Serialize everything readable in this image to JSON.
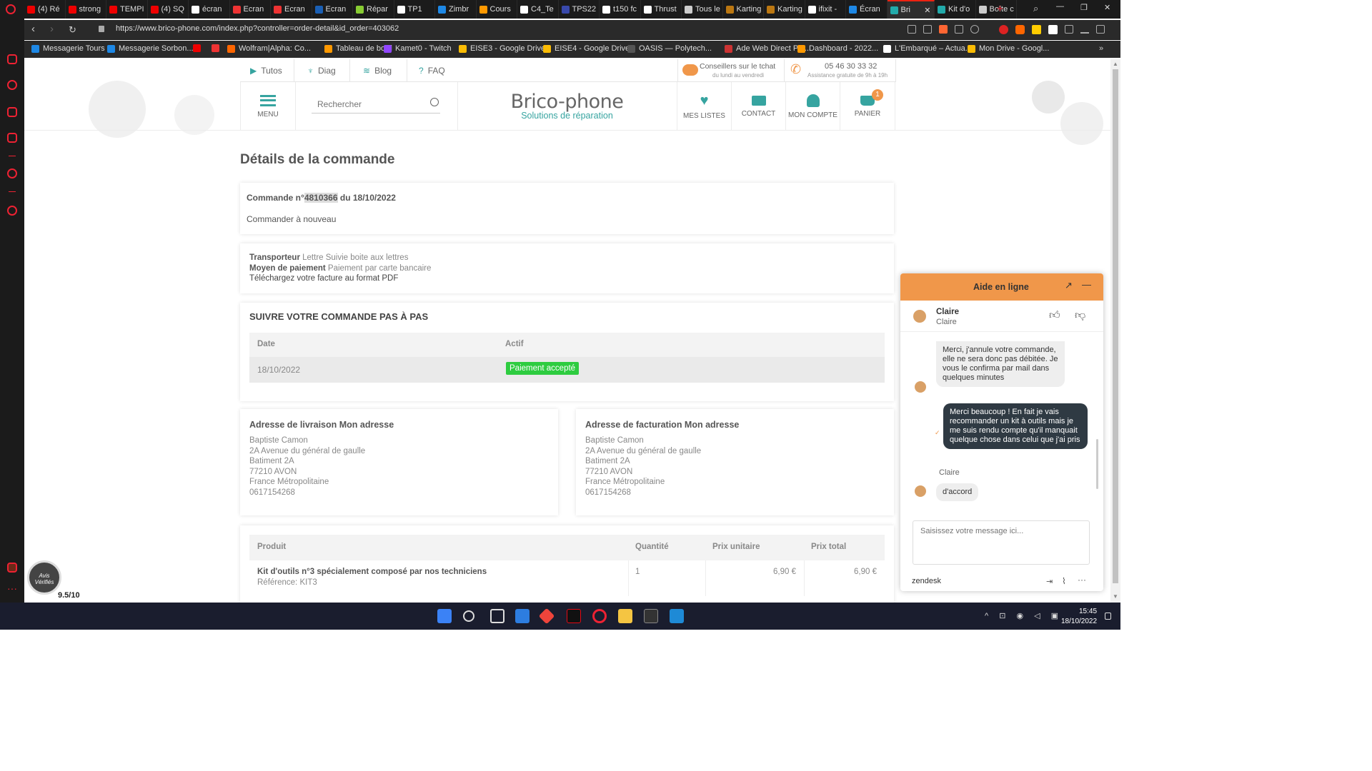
{
  "browser": {
    "tabs": [
      {
        "title": "(4) Ré",
        "color": "#e00"
      },
      {
        "title": "strong",
        "color": "#e00"
      },
      {
        "title": "TEMPI",
        "color": "#e00"
      },
      {
        "title": "(4) SQ",
        "color": "#e00"
      },
      {
        "title": "écran",
        "color": "#fff"
      },
      {
        "title": "Ecran",
        "color": "#e33"
      },
      {
        "title": "Ecran",
        "color": "#e33"
      },
      {
        "title": "Ecran",
        "color": "#1a5fb4"
      },
      {
        "title": "Répar",
        "color": "#8c3"
      },
      {
        "title": "TP1",
        "color": "#fff"
      },
      {
        "title": "Zimbr",
        "color": "#1e88e5"
      },
      {
        "title": "Cours",
        "color": "#f90"
      },
      {
        "title": "C4_Te",
        "color": "#fff"
      },
      {
        "title": "TPS22",
        "color": "#3949ab"
      },
      {
        "title": "t150 fc",
        "color": "#fff"
      },
      {
        "title": "Thrust",
        "color": "#fff"
      },
      {
        "title": "Tous le",
        "color": "#ccc"
      },
      {
        "title": "Karting",
        "color": "#b71"
      },
      {
        "title": "Karting",
        "color": "#b71"
      },
      {
        "title": "ifixit -",
        "color": "#fff"
      },
      {
        "title": "Écran",
        "color": "#1e88e5"
      },
      {
        "title": "Bri",
        "color": "#2aa"
      },
      {
        "title": "Kit d'o",
        "color": "#2aa"
      },
      {
        "title": "Boîte c",
        "color": "#ccc"
      }
    ],
    "url": "https://www.brico-phone.com/index.php?controller=order-detail&id_order=403062",
    "bookmarks": [
      {
        "label": "Messagerie Tours",
        "color": "#1e88e5"
      },
      {
        "label": "Messagerie Sorbon...",
        "color": "#1e88e5"
      },
      {
        "label": "",
        "color": "#e00"
      },
      {
        "label": "",
        "color": "#e33"
      },
      {
        "label": "Wolfram|Alpha: Co...",
        "color": "#f60"
      },
      {
        "label": "Tableau de bord",
        "color": "#f90"
      },
      {
        "label": "Kamet0 - Twitch",
        "color": "#9146ff"
      },
      {
        "label": "EISE3 - Google Drive",
        "color": "#fbbc04"
      },
      {
        "label": "EISE4 - Google Drive",
        "color": "#fbbc04"
      },
      {
        "label": "OASIS — Polytech...",
        "color": "#555"
      },
      {
        "label": "Ade Web Direct Pla...",
        "color": "#c33"
      },
      {
        "label": "Dashboard - 2022...",
        "color": "#f90"
      },
      {
        "label": "L'Embarqué – Actua...",
        "color": "#fff"
      },
      {
        "label": "Mon Drive - Googl...",
        "color": "#fbbc04"
      }
    ]
  },
  "site": {
    "topnav": {
      "tutos": "Tutos",
      "diag": "Diag",
      "blog": "Blog",
      "faq": "FAQ"
    },
    "chat_banner": {
      "title": "Conseillers sur le tchat",
      "sub": "du lundi au vendredi"
    },
    "phone_banner": {
      "number": "05 46 30 33 32",
      "sub": "Assistance gratuite de 9h à 19h"
    },
    "menu_label": "MENU",
    "search_placeholder": "Rechercher",
    "logo": {
      "name": "Brico-phone",
      "tagline": "Solutions de réparation"
    },
    "header_links": {
      "lists": "MES LISTES",
      "contact": "CONTACT",
      "account": "MON COMPTE",
      "cart": "PANIER",
      "cart_count": "1"
    }
  },
  "order": {
    "page_title": "Détails de la commande",
    "line_prefix": "Commande n°",
    "number": "4810366",
    "date_part": " du 18/10/2022",
    "reorder": "Commander à nouveau",
    "carrier_label": "Transporteur",
    "carrier_value": "Lettre Suivie boite aux lettres",
    "payment_label": "Moyen de paiement",
    "payment_value": "Paiement par carte bancaire",
    "invoice_link": "Téléchargez votre facture au format PDF",
    "tracking_title": "SUIVRE VOTRE COMMANDE PAS À PAS",
    "tracking_headers": {
      "date": "Date",
      "active": "Actif"
    },
    "tracking_rows": [
      {
        "date": "18/10/2022",
        "status": "Paiement accepté"
      }
    ],
    "delivery": {
      "title": "Adresse de livraison Mon adresse",
      "lines": [
        "Baptiste Camon",
        "2A Avenue du général de gaulle",
        "Batiment 2A",
        "77210 AVON",
        "France Métropolitaine",
        "0617154268"
      ]
    },
    "billing": {
      "title": "Adresse de facturation Mon adresse",
      "lines": [
        "Baptiste Camon",
        "2A Avenue du général de gaulle",
        "Batiment 2A",
        "77210 AVON",
        "France Métropolitaine",
        "0617154268"
      ]
    },
    "product_headers": {
      "product": "Produit",
      "qty": "Quantité",
      "unit": "Prix unitaire",
      "total": "Prix total"
    },
    "products": [
      {
        "name": "Kit d'outils n°3 spécialement composé par nos techniciens",
        "ref": "Référence: KIT3",
        "qty": "1",
        "unit": "6,90 €",
        "total": "6,90 €"
      }
    ]
  },
  "avis": {
    "label": "Avis Vérifiés",
    "score": "9.5/10"
  },
  "chat": {
    "title": "Aide en ligne",
    "agent_name": "Claire",
    "agent_sub": "Claire",
    "msg1": "Merci, j'annule votre commande, elle ne sera donc pas débitée. Je vous le confirma par mail dans quelques minutes",
    "msg2": "Merci beaucoup ! En fait je vais recommander un kit à outils mais je me suis rendu compte qu'il manquait quelque chose dans celui que j'ai pris",
    "msg3_author": "Claire",
    "msg3": "d'accord",
    "input_placeholder": "Saisissez votre message ici...",
    "footer": "zendesk"
  },
  "taskbar": {
    "time": "15:45",
    "date": "18/10/2022"
  },
  "colors": {
    "teal": "#36a4a0",
    "orange": "#f0974a",
    "green": "#2ecc40",
    "chatdark": "#2f3a43"
  }
}
